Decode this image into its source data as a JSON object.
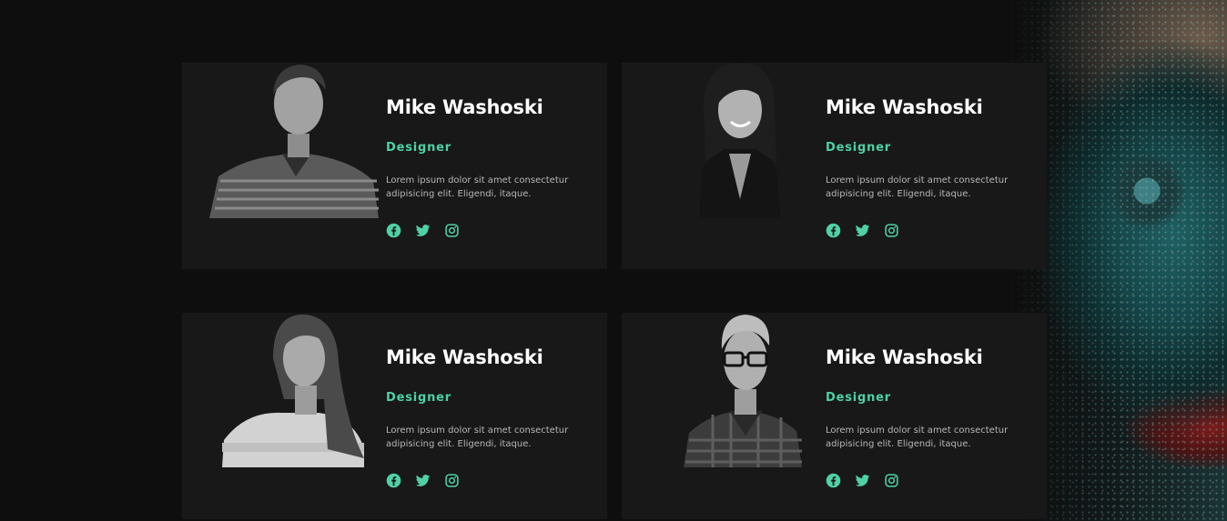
{
  "accent_color": "#4fd1a5",
  "team": [
    {
      "name": "Mike Washoski",
      "role": "Designer",
      "description": "Lorem ipsum dolor sit amet consectetur adipisicing elit. Eligendi, itaque.",
      "socials": [
        "facebook-icon",
        "twitter-icon",
        "instagram-icon"
      ]
    },
    {
      "name": "Mike Washoski",
      "role": "Designer",
      "description": "Lorem ipsum dolor sit amet consectetur adipisicing elit. Eligendi, itaque.",
      "socials": [
        "facebook-icon",
        "twitter-icon",
        "instagram-icon"
      ]
    },
    {
      "name": "Mike Washoski",
      "role": "Designer",
      "description": "Lorem ipsum dolor sit amet consectetur adipisicing elit. Eligendi, itaque.",
      "socials": [
        "facebook-icon",
        "twitter-icon",
        "instagram-icon"
      ]
    },
    {
      "name": "Mike Washoski",
      "role": "Designer",
      "description": "Lorem ipsum dolor sit amet consectetur adipisicing elit. Eligendi, itaque.",
      "socials": [
        "facebook-icon",
        "twitter-icon",
        "instagram-icon"
      ]
    }
  ]
}
